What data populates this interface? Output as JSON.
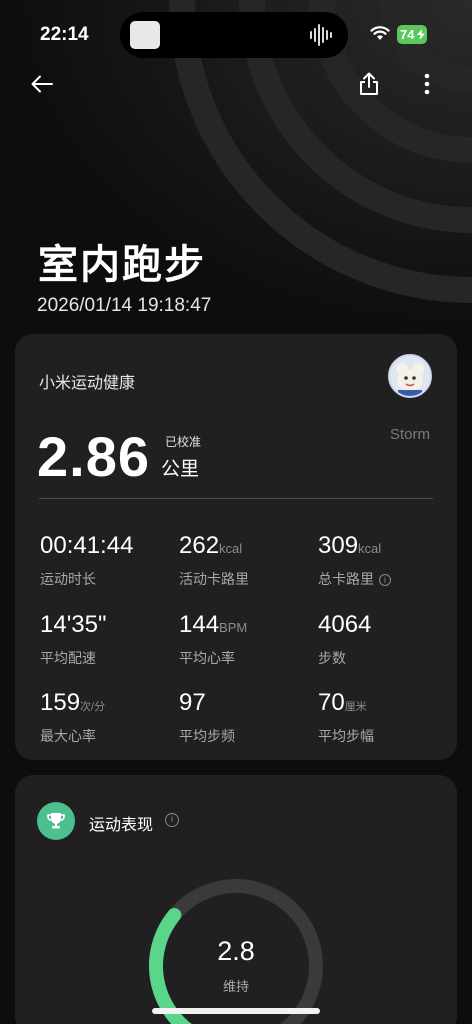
{
  "status_bar": {
    "time": "22:14",
    "battery": "74"
  },
  "header": {
    "title": "室内跑步",
    "datetime": "2026/01/14 19:18:47"
  },
  "summary_card": {
    "app_name": "小米运动健康",
    "username": "Storm",
    "distance": "2.86",
    "calibrated": "已校准",
    "distance_unit": "公里"
  },
  "stats": [
    {
      "value": "00:41:44",
      "unit": "",
      "label": "运动时长"
    },
    {
      "value": "262",
      "unit": "kcal",
      "label": "活动卡路里"
    },
    {
      "value": "309",
      "unit": "kcal",
      "label": "总卡路里"
    },
    {
      "value": "14'35\"",
      "unit": "",
      "label": "平均配速"
    },
    {
      "value": "144",
      "unit": "BPM",
      "label": "平均心率"
    },
    {
      "value": "4064",
      "unit": "",
      "label": "步数"
    },
    {
      "value": "159",
      "unit": "次/分",
      "label": "最大心率"
    },
    {
      "value": "97",
      "unit": "",
      "label": "平均步频"
    },
    {
      "value": "70",
      "unit": "厘米",
      "label": "平均步幅"
    }
  ],
  "performance": {
    "title": "运动表现",
    "score": "2.8",
    "status": "维持",
    "progress_fraction": 0.3
  },
  "colors": {
    "accent_green": "#5ad68a",
    "card_bg": "#202020"
  }
}
